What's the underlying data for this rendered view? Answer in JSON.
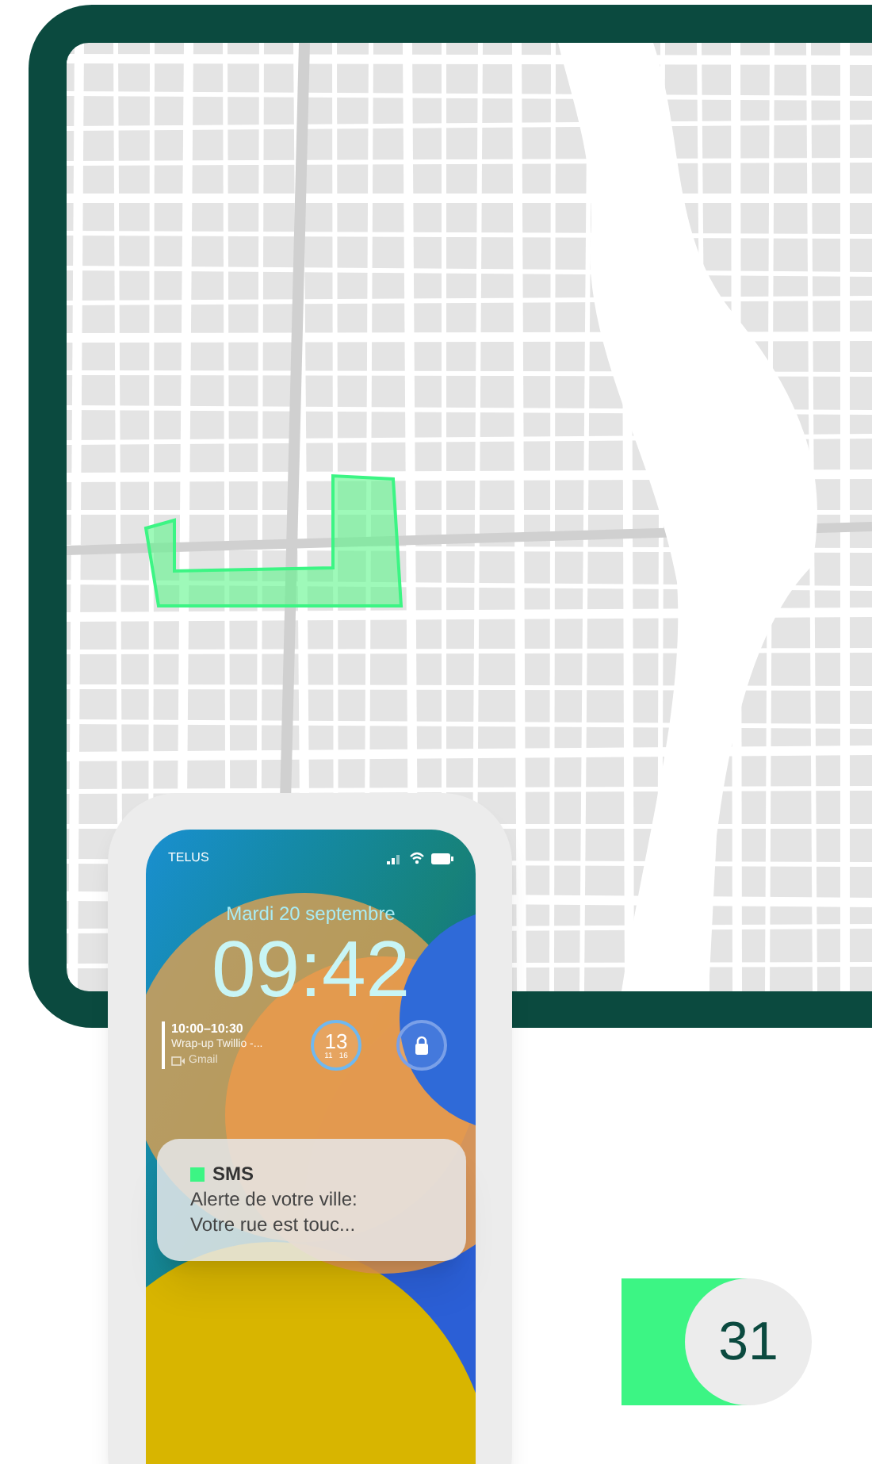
{
  "phone": {
    "carrier": "TELUS",
    "date": "Mardi 20 septembre",
    "time": "09:42",
    "calendar_widget": {
      "time_range": "10:00–10:30",
      "title": "Wrap-up Twillio -...",
      "source": "Gmail"
    },
    "gauge_widget": {
      "value": "13",
      "low": "11",
      "high": "16"
    },
    "notification": {
      "app": "SMS",
      "lines": [
        "Alerte de votre ville:",
        "Votre rue est touc..."
      ]
    }
  },
  "badge": {
    "number": "31"
  }
}
